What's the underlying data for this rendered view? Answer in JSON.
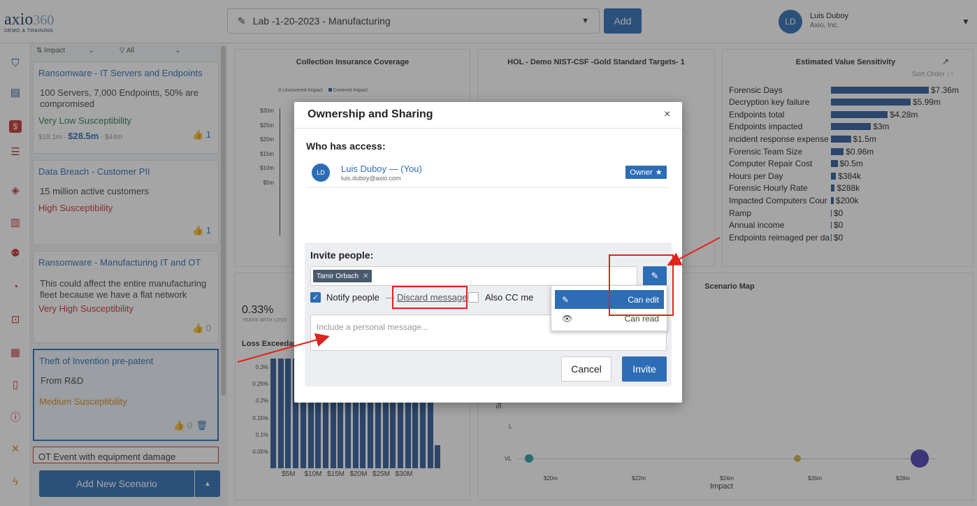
{
  "header": {
    "logo_text": "axio",
    "logo_number": "360",
    "logo_sub": "DEMO & TRAINING",
    "project_title": "Lab -1-20-2023 - Manufacturing",
    "add_label": "Add",
    "user_initials": "LD",
    "user_name": "Luis Duboy",
    "user_org": "Axio, Inc."
  },
  "sidebar_filters": {
    "left": "Impact",
    "right": "All"
  },
  "scenarios": [
    {
      "title": "Ransomware - IT Servers and Endpoints",
      "desc": "100 Servers, 7,000 Endpoints, 50% are compromised",
      "susceptibility": "Very Low Susceptibility",
      "low": "$18.1m",
      "mid": "$28.5m",
      "high": "$44m",
      "likes": "1"
    },
    {
      "title": "Data Breach - Customer PII",
      "desc": "15 million active customers",
      "susceptibility": "High Susceptibility",
      "likes": "1"
    },
    {
      "title": "Ransomware - Manufacturing IT and OT",
      "desc": "This could affect the entire manufacturing fleet because we have a flat network",
      "susceptibility": "Very High Susceptibility",
      "likes": "0"
    },
    {
      "title": "Theft of Invention pre-patent",
      "desc": "From R&D",
      "susceptibility": "Medium Susceptibility",
      "likes": "0"
    },
    {
      "title": "OT Event with equipment damage"
    }
  ],
  "add_scenario_label": "Add New Scenario",
  "panels": {
    "coverage_title": "Collection Insurance Coverage",
    "coverage_legend": [
      "Uncovered Impact",
      "Covered Impact"
    ],
    "coverage_y": [
      "$30m",
      "$25m",
      "$20m",
      "$15m",
      "$10m",
      "$5m"
    ],
    "hol_title": "HOL - Demo NIST-CSF -Gold Standard Targets- 1",
    "evs_title": "Estimated Value Sensitivity",
    "evs_sort": "Sort Order",
    "loss_pct": "0.33%",
    "loss_pct_sub": "YEARS WITH LOSS",
    "loss_title": "Loss Exceedance",
    "loss_y": [
      "0.3%",
      "0.25%",
      "0.2%",
      "0.15%",
      "0.1%",
      "0.05%"
    ],
    "loss_x": [
      "$5M",
      "$10M",
      "$15M",
      "$20M",
      "$25M",
      "$30M"
    ],
    "scenario_map_title": "Scenario Map",
    "map_y": [
      "L",
      "VL"
    ],
    "map_ylabel": "Susc",
    "map_x": [
      "$20m",
      "$22m",
      "$24m",
      "$26m",
      "$28m"
    ],
    "map_xlabel": "Impact"
  },
  "chart_data": [
    {
      "type": "bar",
      "title": "Estimated Value Sensitivity",
      "categories": [
        "Forensic Days",
        "Decryption key failure",
        "Endpoints total",
        "Endpoints impacted",
        "incident response expense",
        "Forensic Team Size",
        "Computer Repair Cost",
        "Hours per Day",
        "Forensic Hourly Rate",
        "Impacted Computers Cour",
        "Ramp",
        "Annual income",
        "Endpoints reimaged per da"
      ],
      "values": [
        7.36,
        5.99,
        4.28,
        3,
        1.5,
        0.96,
        0.5,
        0.384,
        0.288,
        0.2,
        0,
        0,
        0
      ],
      "value_labels": [
        "$7.36m",
        "$5.99m",
        "$4.28m",
        "$3m",
        "$1.5m",
        "$0.96m",
        "$0.5m",
        "$384k",
        "$288k",
        "$200k",
        "$0",
        "$0",
        "$0"
      ]
    },
    {
      "type": "bar",
      "title": "Loss Exceedance",
      "values": [
        0.33,
        0.33,
        0.33,
        0.33,
        0.33,
        0.33,
        0.33,
        0.33,
        0.33,
        0.33,
        0.33,
        0.33,
        0.33,
        0.33,
        0.33,
        0.33,
        0.33,
        0.32,
        0.32,
        0.31,
        0.28,
        0.22,
        0.07
      ],
      "ylim": [
        0,
        0.33
      ]
    }
  ],
  "modal": {
    "title": "Ownership and Sharing",
    "close": "×",
    "who_label": "Who has access:",
    "owner_initials": "LD",
    "owner_name": "Luis Duboy — (You)",
    "owner_email": "luis.duboy@axio.com",
    "owner_badge": "Owner",
    "invite_label": "Invite people:",
    "tag": "Tamir Orbach",
    "notify_label": "Notify people",
    "dash": "—",
    "discard_label": "Discard message",
    "cc_label": "Also CC me",
    "message_placeholder": "Include a personal message...",
    "cancel": "Cancel",
    "invite": "Invite",
    "perm_edit": "Can edit",
    "perm_read": "Can read"
  },
  "colors": {
    "accent": "#2d6db5",
    "annotation": "#e0231b"
  }
}
